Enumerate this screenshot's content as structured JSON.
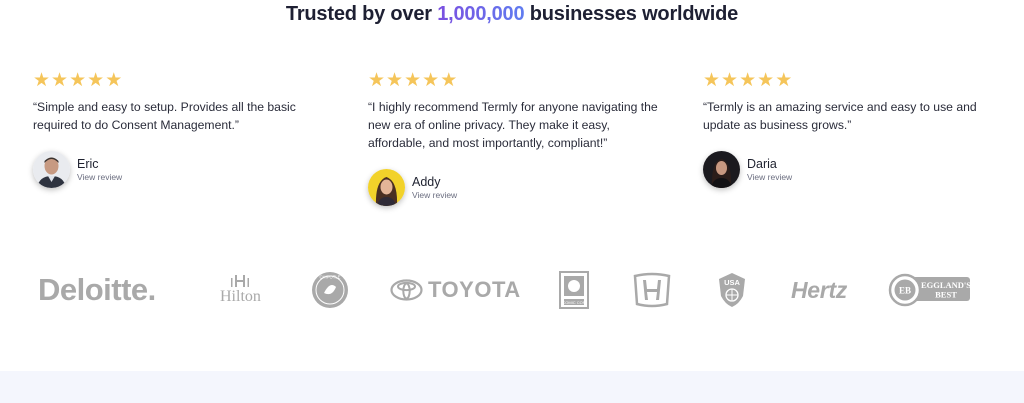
{
  "headline": {
    "prefix": "Trusted by over ",
    "highlight": "1,000,000",
    "suffix": " businesses worldwide"
  },
  "reviews": [
    {
      "rating": 5,
      "quote": "“Simple and easy to setup. Provides all the basic required to do Consent Management.”",
      "name": "Eric",
      "link": "View review"
    },
    {
      "rating": 5,
      "quote": "“I highly recommend Termly for anyone navigating the new era of online privacy. They make it easy, affordable, and most importantly, compliant!”",
      "name": "Addy",
      "link": "View review"
    },
    {
      "rating": 5,
      "quote": "“Termly is an amazing service and easy to use and update as business grows.”",
      "name": "Daria",
      "link": "View review"
    }
  ],
  "logos": {
    "deloitte": "Deloitte.",
    "hilton": "Hilton",
    "toyota": "TOYOTA",
    "hertz": "Hertz",
    "egglands_line1": "EGGLAND'S",
    "egglands_line2": "BEST",
    "chipotle": "CHIPOTLE",
    "comiccon": "COMIC CON",
    "usa": "USA"
  },
  "colors": {
    "star": "#f5c55a",
    "accent_start": "#7b4fe0",
    "accent_end": "#5f7cf0",
    "logo_gray": "#a9a9a9",
    "footer_band": "#f4f6fd"
  }
}
